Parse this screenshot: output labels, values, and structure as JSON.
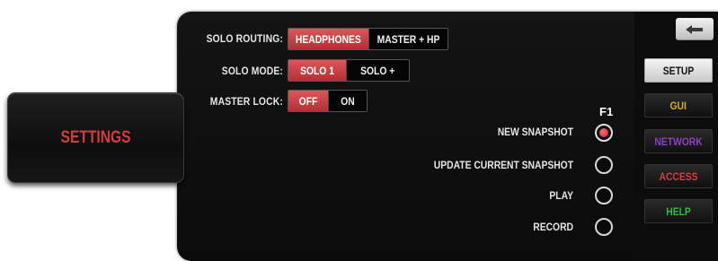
{
  "settings_tab": {
    "label": "SETTINGS"
  },
  "solo_routing": {
    "label": "SOLO ROUTING:",
    "options": [
      "HEADPHONES",
      "MASTER + HP"
    ],
    "selected": "HEADPHONES"
  },
  "solo_mode": {
    "label": "SOLO MODE:",
    "options": [
      "SOLO 1",
      "SOLO +"
    ],
    "selected": "SOLO 1"
  },
  "master_lock": {
    "label": "MASTER LOCK:",
    "options": [
      "OFF",
      "ON"
    ],
    "selected": "OFF"
  },
  "snapshot": {
    "header": "F1",
    "options": [
      "NEW SNAPSHOT",
      "UPDATE CURRENT SNAPSHOT",
      "PLAY",
      "RECORD"
    ],
    "selected": "NEW SNAPSHOT"
  },
  "sidebar": {
    "back_icon": "back-arrow-icon",
    "items": [
      {
        "label": "SETUP",
        "color": "#111111",
        "active": true
      },
      {
        "label": "GUI",
        "color": "#d6b11c",
        "active": false
      },
      {
        "label": "NETWORK",
        "color": "#8f3fc2",
        "active": false
      },
      {
        "label": "ACCESS",
        "color": "#d13e40",
        "active": false
      },
      {
        "label": "HELP",
        "color": "#39b84a",
        "active": false
      }
    ]
  },
  "colors": {
    "accent_red": "#c8383c",
    "panel_bg": "#0f0f0f"
  }
}
